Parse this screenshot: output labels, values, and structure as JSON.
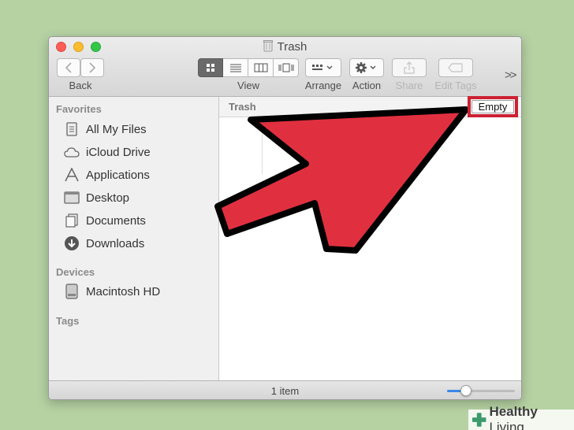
{
  "window": {
    "title": "Trash",
    "toolbar": {
      "back_label": "Back",
      "view_label": "View",
      "arrange_label": "Arrange",
      "action_label": "Action",
      "share_label": "Share",
      "edit_tags_label": "Edit Tags",
      "more": ">>"
    }
  },
  "sidebar": {
    "favorites_header": "Favorites",
    "favorites": [
      {
        "label": "All My Files",
        "icon": "all-files-icon"
      },
      {
        "label": "iCloud Drive",
        "icon": "cloud-icon"
      },
      {
        "label": "Applications",
        "icon": "applications-icon"
      },
      {
        "label": "Desktop",
        "icon": "desktop-icon"
      },
      {
        "label": "Documents",
        "icon": "documents-icon"
      },
      {
        "label": "Downloads",
        "icon": "downloads-icon"
      }
    ],
    "devices_header": "Devices",
    "devices": [
      {
        "label": "Macintosh HD",
        "icon": "hard-drive-icon"
      }
    ],
    "tags_header": "Tags"
  },
  "main": {
    "path_label": "Trash",
    "empty_button": "Empty"
  },
  "status": {
    "item_count": "1 item",
    "zoom_level": 0.28
  },
  "overlay": {
    "arrow_color": "#e0303f",
    "highlight_color": "#cc2133"
  },
  "brand": {
    "prefix": "Healthy",
    "suffix": " Living"
  }
}
